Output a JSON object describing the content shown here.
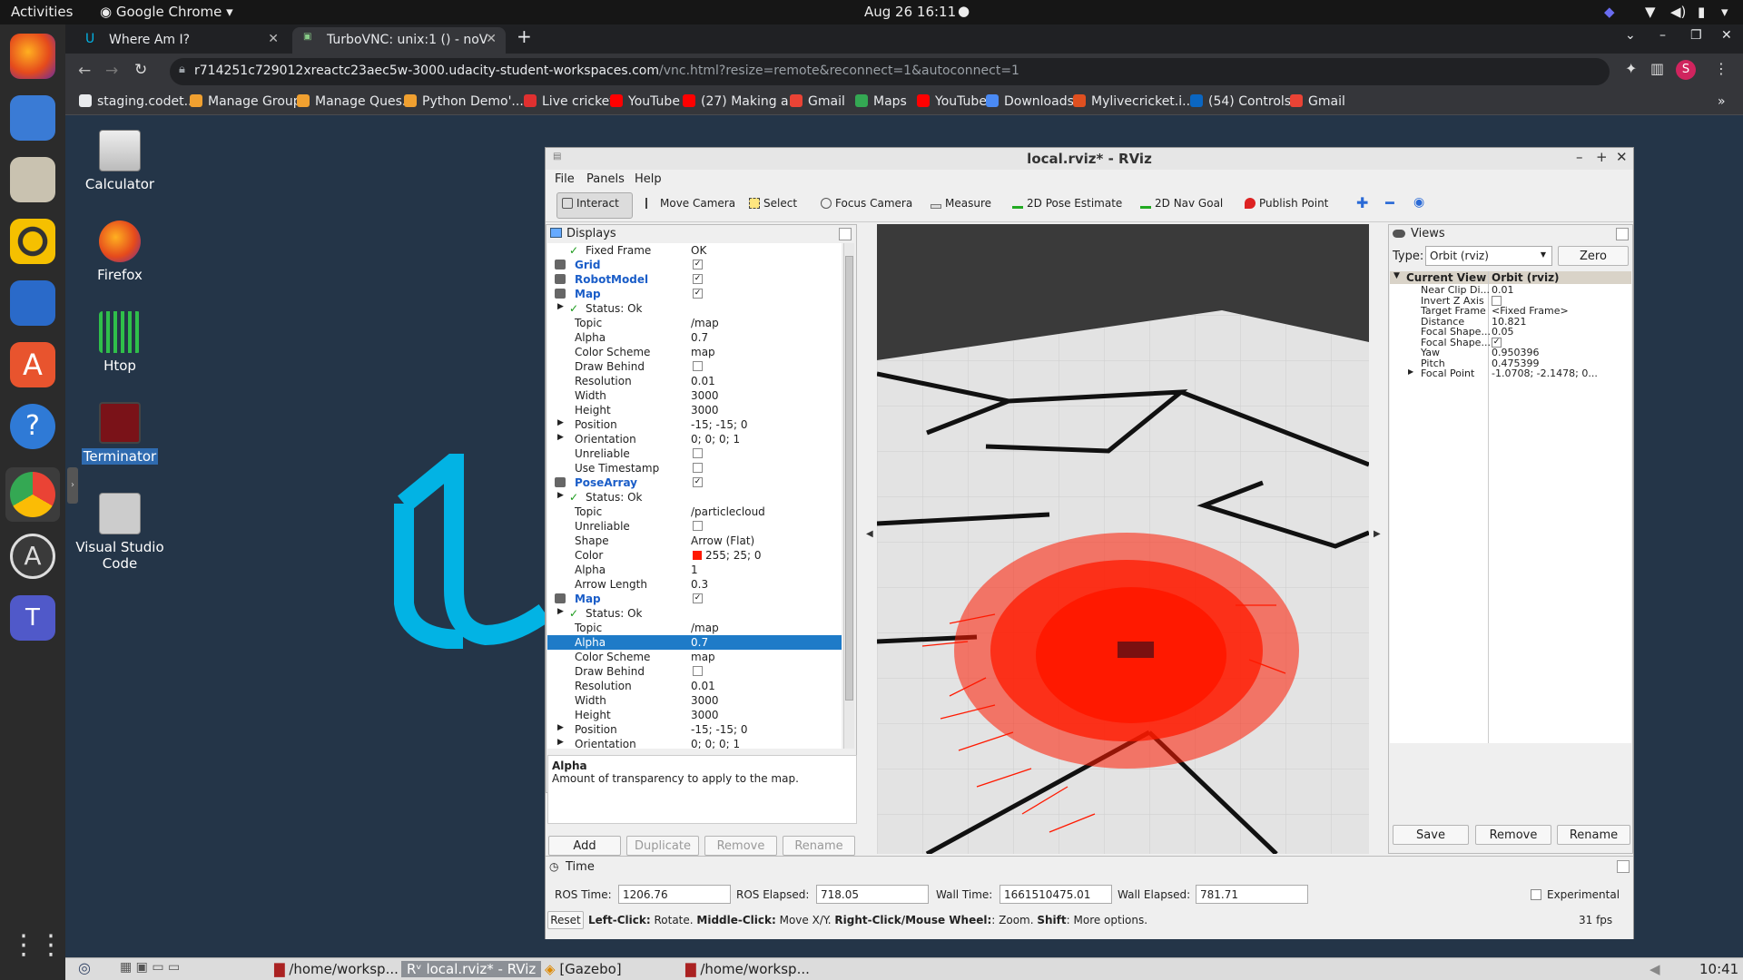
{
  "topbar": {
    "activities": "Activities",
    "app": "Google Chrome",
    "clock": "Aug 26  16:11"
  },
  "chrome": {
    "tabs": [
      {
        "title": "Where Am I?"
      },
      {
        "title": "TurboVNC: unix:1 () - noV"
      }
    ],
    "url_host": "r714251c729012xreactc23aec5w-3000.udacity-student-workspaces.com",
    "url_path": "/vnc.html?resize=remote&reconnect=1&autoconnect=1",
    "profile_initial": "S",
    "bookmarks": [
      {
        "label": "staging.codet...",
        "color": "#e8eaed"
      },
      {
        "label": "Manage Groups",
        "color": "#f0a030"
      },
      {
        "label": "Manage Ques...",
        "color": "#f0a030"
      },
      {
        "label": "Python Demo'...",
        "color": "#f0a030"
      },
      {
        "label": "Live cricket",
        "color": "#e03030"
      },
      {
        "label": "YouTube",
        "color": "#ff0000"
      },
      {
        "label": "(27) Making a...",
        "color": "#ff0000"
      },
      {
        "label": "Gmail",
        "color": "#ea4335"
      },
      {
        "label": "Maps",
        "color": "#34a853"
      },
      {
        "label": "YouTube",
        "color": "#ff0000"
      },
      {
        "label": "Downloads",
        "color": "#4a8af4"
      },
      {
        "label": "Mylivecricket.i...",
        "color": "#e05020"
      },
      {
        "label": "(54) Controls...",
        "color": "#0a66c2"
      },
      {
        "label": "Gmail",
        "color": "#ea4335"
      }
    ]
  },
  "desktop": {
    "icons": [
      {
        "label": "Calculator"
      },
      {
        "label": "Firefox"
      },
      {
        "label": "Htop"
      },
      {
        "label": "Terminator"
      },
      {
        "label": "Visual Studio Code"
      }
    ]
  },
  "rviz": {
    "title": "local.rviz* - RViz",
    "menu": [
      "File",
      "Panels",
      "Help"
    ],
    "tools": [
      "Interact",
      "Move Camera",
      "Select",
      "Focus Camera",
      "Measure",
      "2D Pose Estimate",
      "2D Nav Goal",
      "Publish Point"
    ],
    "displays_title": "Displays",
    "tree": [
      {
        "k": "Fixed Frame",
        "v": "OK",
        "ind": 42,
        "check": true
      },
      {
        "k": "Grid",
        "v": "",
        "ind": 30,
        "blue": true,
        "cb": "✓"
      },
      {
        "k": "RobotModel",
        "v": "",
        "ind": 30,
        "blue": true,
        "cb": "✓"
      },
      {
        "k": "Map",
        "v": "",
        "ind": 30,
        "blue": true,
        "cb": "✓"
      },
      {
        "k": "Status: Ok",
        "v": "",
        "ind": 42,
        "check": true,
        "arrow": true
      },
      {
        "k": "Topic",
        "v": "/map",
        "ind": 30
      },
      {
        "k": "Alpha",
        "v": "0.7",
        "ind": 30
      },
      {
        "k": "Color Scheme",
        "v": "map",
        "ind": 30
      },
      {
        "k": "Draw Behind",
        "v": "",
        "ind": 30,
        "cb": ""
      },
      {
        "k": "Resolution",
        "v": "0.01",
        "ind": 30
      },
      {
        "k": "Width",
        "v": "3000",
        "ind": 30
      },
      {
        "k": "Height",
        "v": "3000",
        "ind": 30
      },
      {
        "k": "Position",
        "v": "-15; -15; 0",
        "ind": 30,
        "arrow": true
      },
      {
        "k": "Orientation",
        "v": "0; 0; 0; 1",
        "ind": 30,
        "arrow": true
      },
      {
        "k": "Unreliable",
        "v": "",
        "ind": 30,
        "cb": ""
      },
      {
        "k": "Use Timestamp",
        "v": "",
        "ind": 30,
        "cb": ""
      },
      {
        "k": "PoseArray",
        "v": "",
        "ind": 30,
        "blue": true,
        "cb": "✓"
      },
      {
        "k": "Status: Ok",
        "v": "",
        "ind": 42,
        "check": true,
        "arrow": true
      },
      {
        "k": "Topic",
        "v": "/particlecloud",
        "ind": 30
      },
      {
        "k": "Unreliable",
        "v": "",
        "ind": 30,
        "cb": ""
      },
      {
        "k": "Shape",
        "v": "Arrow (Flat)",
        "ind": 30
      },
      {
        "k": "Color",
        "v": "255; 25; 0",
        "ind": 30,
        "swatch": "#ff1900"
      },
      {
        "k": "Alpha",
        "v": "1",
        "ind": 30
      },
      {
        "k": "Arrow Length",
        "v": "0.3",
        "ind": 30
      },
      {
        "k": "Map",
        "v": "",
        "ind": 30,
        "blue": true,
        "cb": "✓"
      },
      {
        "k": "Status: Ok",
        "v": "",
        "ind": 42,
        "check": true,
        "arrow": true
      },
      {
        "k": "Topic",
        "v": "/map",
        "ind": 30
      },
      {
        "k": "Alpha",
        "v": "0.7",
        "ind": 30,
        "sel": true
      },
      {
        "k": "Color Scheme",
        "v": "map",
        "ind": 30
      },
      {
        "k": "Draw Behind",
        "v": "",
        "ind": 30,
        "cb": ""
      },
      {
        "k": "Resolution",
        "v": "0.01",
        "ind": 30
      },
      {
        "k": "Width",
        "v": "3000",
        "ind": 30
      },
      {
        "k": "Height",
        "v": "3000",
        "ind": 30
      },
      {
        "k": "Position",
        "v": "-15; -15; 0",
        "ind": 30,
        "arrow": true
      },
      {
        "k": "Orientation",
        "v": "0; 0; 0; 1",
        "ind": 30,
        "arrow": true
      }
    ],
    "desc_title": "Alpha",
    "desc_text": "Amount of transparency to apply to the map.",
    "display_buttons": [
      "Add",
      "Duplicate",
      "Remove",
      "Rename"
    ],
    "views": {
      "title": "Views",
      "type_label": "Type:",
      "type_value": "Orbit (rviz)",
      "zero": "Zero",
      "header_k": "Current View",
      "header_v": "Orbit (rviz)",
      "rows": [
        {
          "k": "Near Clip Di...",
          "v": "0.01"
        },
        {
          "k": "Invert Z Axis",
          "v": "",
          "cb": ""
        },
        {
          "k": "Target Frame",
          "v": "<Fixed Frame>"
        },
        {
          "k": "Distance",
          "v": "10.821"
        },
        {
          "k": "Focal Shape...",
          "v": "0.05"
        },
        {
          "k": "Focal Shape...",
          "v": "",
          "cb": "✓"
        },
        {
          "k": "Yaw",
          "v": "0.950396"
        },
        {
          "k": "Pitch",
          "v": "0.475399"
        },
        {
          "k": "Focal Point",
          "v": "-1.0708; -2.1478; 0...",
          "arrow": true
        }
      ],
      "buttons": [
        "Save",
        "Remove",
        "Rename"
      ]
    },
    "time": {
      "title": "Time",
      "ros_time_label": "ROS Time:",
      "ros_time": "1206.76",
      "ros_elapsed_label": "ROS Elapsed:",
      "ros_elapsed": "718.05",
      "wall_time_label": "Wall Time:",
      "wall_time": "1661510475.01",
      "wall_elapsed_label": "Wall Elapsed:",
      "wall_elapsed": "781.71",
      "experimental": "Experimental"
    },
    "status": {
      "reset": "Reset",
      "hint_1": "Left-Click:",
      "hint_1v": " Rotate. ",
      "hint_2": "Middle-Click:",
      "hint_2v": " Move X/Y. ",
      "hint_3": "Right-Click/Mouse Wheel:",
      "hint_3v": ": Zoom. ",
      "hint_4": "Shift",
      "hint_4v": ": More options.",
      "fps": "31 fps"
    }
  },
  "taskbar": {
    "items": [
      "/home/worksp...",
      "local.rviz* - RViz",
      "[Gazebo]",
      "/home/worksp..."
    ],
    "clock": "10:41"
  }
}
